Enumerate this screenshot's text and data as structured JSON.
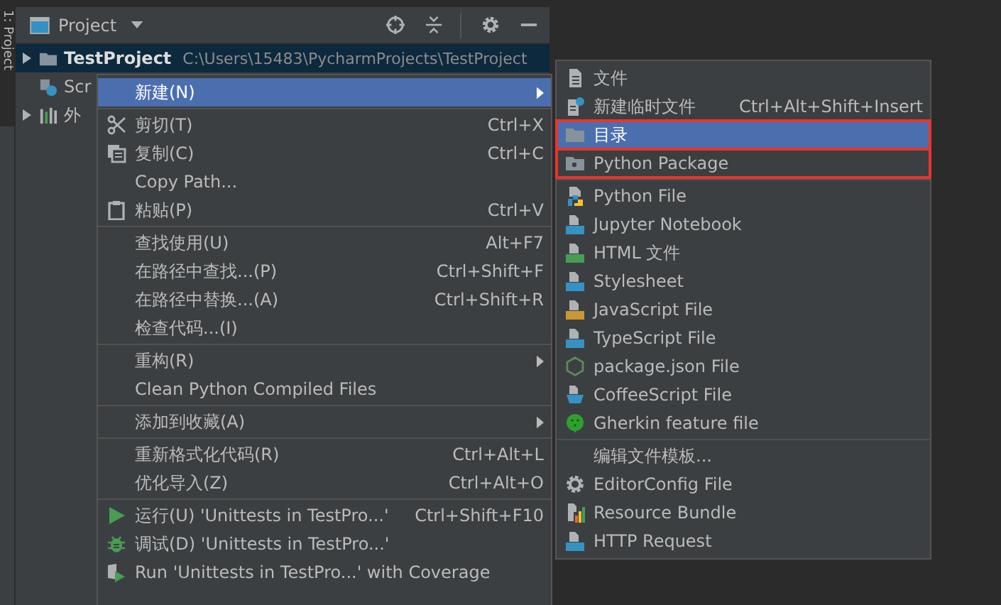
{
  "side_tab": {
    "label": "1: Project",
    "selected": true
  },
  "panel": {
    "title": "Project"
  },
  "tree": [
    {
      "label": "TestProject",
      "path": "C:\\Users\\15483\\PycharmProjects\\TestProject",
      "kind": "folder",
      "expanded": false,
      "selected": true
    },
    {
      "label": "Scr",
      "kind": "scratches",
      "selected": false
    },
    {
      "label": "外",
      "kind": "libraries",
      "expanded": false,
      "selected": false
    }
  ],
  "context_menu": {
    "groups": [
      [
        {
          "label": "新建(N)",
          "kind": "none",
          "submenu": true,
          "selected": true
        }
      ],
      [
        {
          "label": "剪切(T)",
          "shortcut": "Ctrl+X",
          "kind": "cut",
          "submenu": false,
          "selected": false
        },
        {
          "label": "复制(C)",
          "shortcut": "Ctrl+C",
          "kind": "copy",
          "submenu": false,
          "selected": false
        },
        {
          "label": "Copy Path...",
          "kind": "none",
          "submenu": false,
          "selected": false
        },
        {
          "label": "粘贴(P)",
          "shortcut": "Ctrl+V",
          "kind": "paste",
          "submenu": false,
          "selected": false
        }
      ],
      [
        {
          "label": "查找使用(U)",
          "shortcut": "Alt+F7",
          "kind": "none",
          "submenu": false,
          "selected": false
        },
        {
          "label": "在路径中查找...(P)",
          "shortcut": "Ctrl+Shift+F",
          "kind": "none",
          "submenu": false,
          "selected": false
        },
        {
          "label": "在路径中替换...(A)",
          "shortcut": "Ctrl+Shift+R",
          "kind": "none",
          "submenu": false,
          "selected": false
        },
        {
          "label": "检查代码...(I)",
          "kind": "none",
          "submenu": false,
          "selected": false
        }
      ],
      [
        {
          "label": "重构(R)",
          "kind": "none",
          "submenu": true,
          "selected": false
        },
        {
          "label": "Clean Python Compiled Files",
          "kind": "none",
          "submenu": false,
          "selected": false
        }
      ],
      [
        {
          "label": "添加到收藏(A)",
          "kind": "none",
          "submenu": true,
          "selected": false
        }
      ],
      [
        {
          "label": "重新格式化代码(R)",
          "shortcut": "Ctrl+Alt+L",
          "kind": "none",
          "submenu": false,
          "selected": false
        },
        {
          "label": "优化导入(Z)",
          "shortcut": "Ctrl+Alt+O",
          "kind": "none",
          "submenu": false,
          "selected": false
        }
      ],
      [
        {
          "label": "运行(U) 'Unittests in TestPro...'",
          "shortcut": "Ctrl+Shift+F10",
          "kind": "run",
          "submenu": false,
          "selected": false
        },
        {
          "label": "调试(D) 'Unittests in TestPro...'",
          "kind": "debug",
          "submenu": false,
          "selected": false
        },
        {
          "label": "Run 'Unittests in TestPro...' with Coverage",
          "kind": "coverage",
          "submenu": false,
          "selected": false
        }
      ]
    ]
  },
  "submenu": {
    "groups": [
      [
        {
          "label": "文件",
          "kind": "file",
          "selected": false,
          "outlined": false
        },
        {
          "label": "新建临时文件",
          "shortcut": "Ctrl+Alt+Shift+Insert",
          "kind": "scratch",
          "selected": false,
          "outlined": false
        },
        {
          "label": "目录",
          "kind": "folder",
          "selected": true,
          "outlined": true
        },
        {
          "label": "Python Package",
          "kind": "package",
          "selected": false,
          "outlined": true
        }
      ],
      [
        {
          "label": "Python File",
          "kind": "python",
          "selected": false,
          "outlined": false
        },
        {
          "label": "Jupyter Notebook",
          "kind": "badge-blue",
          "selected": false,
          "outlined": false
        },
        {
          "label": "HTML 文件",
          "kind": "badge-green",
          "selected": false,
          "outlined": false
        },
        {
          "label": "Stylesheet",
          "kind": "badge-blue",
          "selected": false,
          "outlined": false
        },
        {
          "label": "JavaScript File",
          "kind": "badge-yellow",
          "selected": false,
          "outlined": false
        },
        {
          "label": "TypeScript File",
          "kind": "badge-blue",
          "selected": false,
          "outlined": false
        },
        {
          "label": "package.json File",
          "kind": "hexagon",
          "selected": false,
          "outlined": false
        },
        {
          "label": "CoffeeScript File",
          "kind": "cup",
          "selected": false,
          "outlined": false
        },
        {
          "label": "Gherkin feature file",
          "kind": "cucumber",
          "selected": false,
          "outlined": false
        }
      ],
      [
        {
          "label": "编辑文件模板...",
          "kind": "none",
          "selected": false,
          "outlined": false
        },
        {
          "label": "EditorConfig File",
          "kind": "gear",
          "selected": false,
          "outlined": false
        },
        {
          "label": "Resource Bundle",
          "kind": "bundle",
          "selected": false,
          "outlined": false
        },
        {
          "label": "HTTP Request",
          "kind": "badge-blue",
          "selected": false,
          "outlined": false
        }
      ]
    ]
  }
}
